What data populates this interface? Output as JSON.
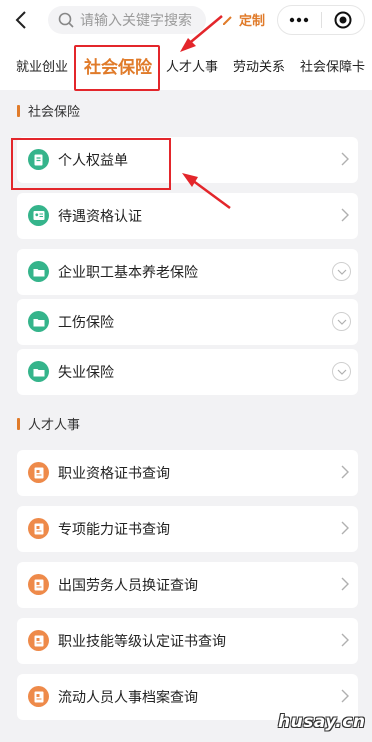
{
  "header": {
    "search_placeholder": "请输入关键字搜索",
    "custom_label": "定制",
    "icons": [
      "back-icon",
      "search-icon",
      "pencil-icon",
      "more-icon",
      "close-mini-program-icon"
    ]
  },
  "tabs": [
    {
      "label": "就业创业",
      "active": false
    },
    {
      "label": "社会保险",
      "active": true
    },
    {
      "label": "人才人事",
      "active": false
    },
    {
      "label": "劳动关系",
      "active": false
    },
    {
      "label": "社会保障卡",
      "active": false
    }
  ],
  "sections": [
    {
      "title": "社会保险",
      "items": [
        {
          "label": "个人权益单",
          "icon": "document-icon",
          "action": "chevron"
        },
        {
          "label": "待遇资格认证",
          "icon": "id-card-icon",
          "action": "chevron"
        },
        {
          "label": "企业职工基本养老保险",
          "icon": "folder-icon",
          "action": "expand"
        },
        {
          "label": "工伤保险",
          "icon": "folder-icon",
          "action": "expand"
        },
        {
          "label": "失业保险",
          "icon": "folder-icon",
          "action": "expand"
        }
      ]
    },
    {
      "title": "人才人事",
      "items": [
        {
          "label": "职业资格证书查询",
          "icon": "certificate-icon",
          "action": "chevron"
        },
        {
          "label": "专项能力证书查询",
          "icon": "certificate-icon",
          "action": "chevron"
        },
        {
          "label": "出国劳务人员换证查询",
          "icon": "certificate-icon",
          "action": "chevron"
        },
        {
          "label": "职业技能等级认定证书查询",
          "icon": "certificate-icon",
          "action": "chevron"
        },
        {
          "label": "流动人员人事档案查询",
          "icon": "certificate-icon",
          "action": "chevron"
        }
      ]
    }
  ],
  "colors": {
    "accent": "#e07b2a",
    "green_icon": "#35b48b",
    "orange_icon": "#ee8a4a",
    "annotation_red": "#e3262b",
    "background": "#f2f2f4"
  },
  "watermark": "husay.cn"
}
